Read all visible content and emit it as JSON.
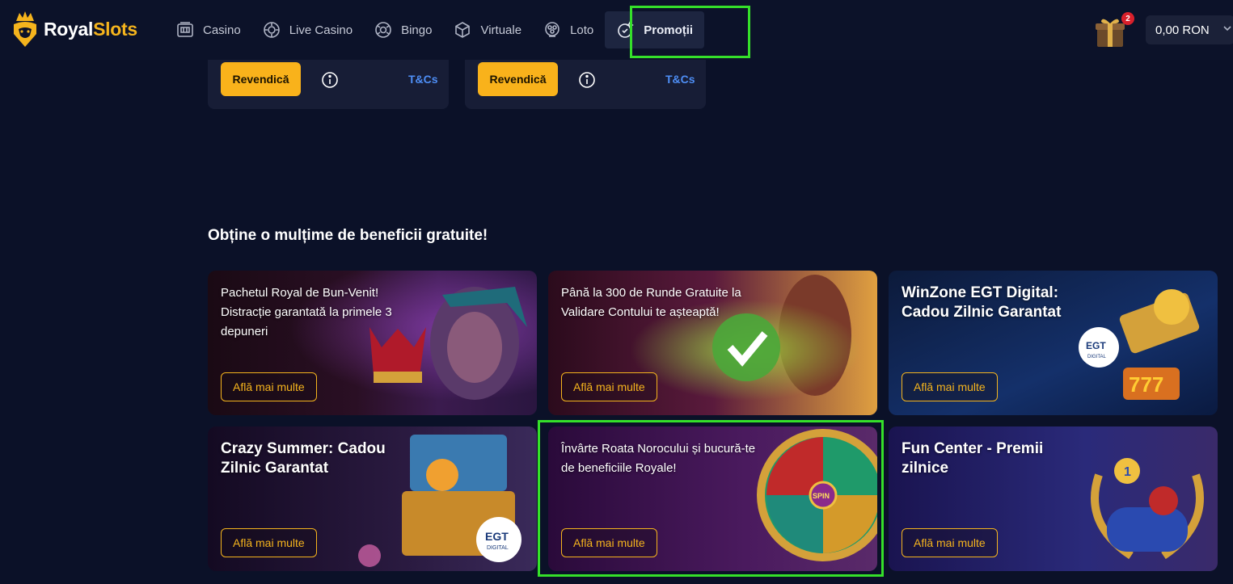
{
  "brand": {
    "name_part1": "Royal",
    "name_part2": "Slots"
  },
  "nav": {
    "items": [
      {
        "label": "Casino",
        "icon": "slot-machine-icon"
      },
      {
        "label": "Live Casino",
        "icon": "poker-chip-icon"
      },
      {
        "label": "Bingo",
        "icon": "bingo-ball-icon"
      },
      {
        "label": "Virtuale",
        "icon": "cube-icon"
      },
      {
        "label": "Loto",
        "icon": "lottery-balls-icon"
      },
      {
        "label": "Promoții",
        "icon": "promo-badge-icon",
        "active": true
      }
    ]
  },
  "header": {
    "gift_count": "2",
    "balance": "0,00 RON"
  },
  "claims": [
    {
      "button": "Revendică",
      "link": "T&Cs"
    },
    {
      "button": "Revendică",
      "link": "T&Cs"
    }
  ],
  "section": {
    "title": "Obține o mulțime de beneficii gratuite!"
  },
  "promos": [
    {
      "title": "Pachetul Royal de Bun-Venit! Distracție garantată la primele 3 depuneri",
      "button": "Află mai multe"
    },
    {
      "title": "Până la 300 de Runde Gratuite la Validare Contului te așteaptă!",
      "button": "Află mai multe"
    },
    {
      "title": "WinZone EGT Digital: Cadou Zilnic Garantat",
      "button": "Află mai multe",
      "badge": "EGT DIGITAL",
      "badge_main": "EGT",
      "badge_sub": "DIGITAL",
      "slot_text": "777"
    },
    {
      "title": "Crazy Summer: Cadou Zilnic Garantat",
      "button": "Află mai multe",
      "badge": "EGT DIGITAL",
      "badge_main": "EGT",
      "badge_sub": "DIGITAL"
    },
    {
      "title": "Învârte Roata Norocului și bucură-te de beneficiile Royale!",
      "button": "Află mai multe",
      "wheel_center": "SPIN"
    },
    {
      "title": "Fun Center - Premii zilnice",
      "button": "Află mai multe",
      "trophy_num": "1"
    }
  ],
  "colors": {
    "background": "#0b1128",
    "accent": "#f9b21b",
    "link": "#4e8ef5",
    "highlight": "#35e02a"
  }
}
